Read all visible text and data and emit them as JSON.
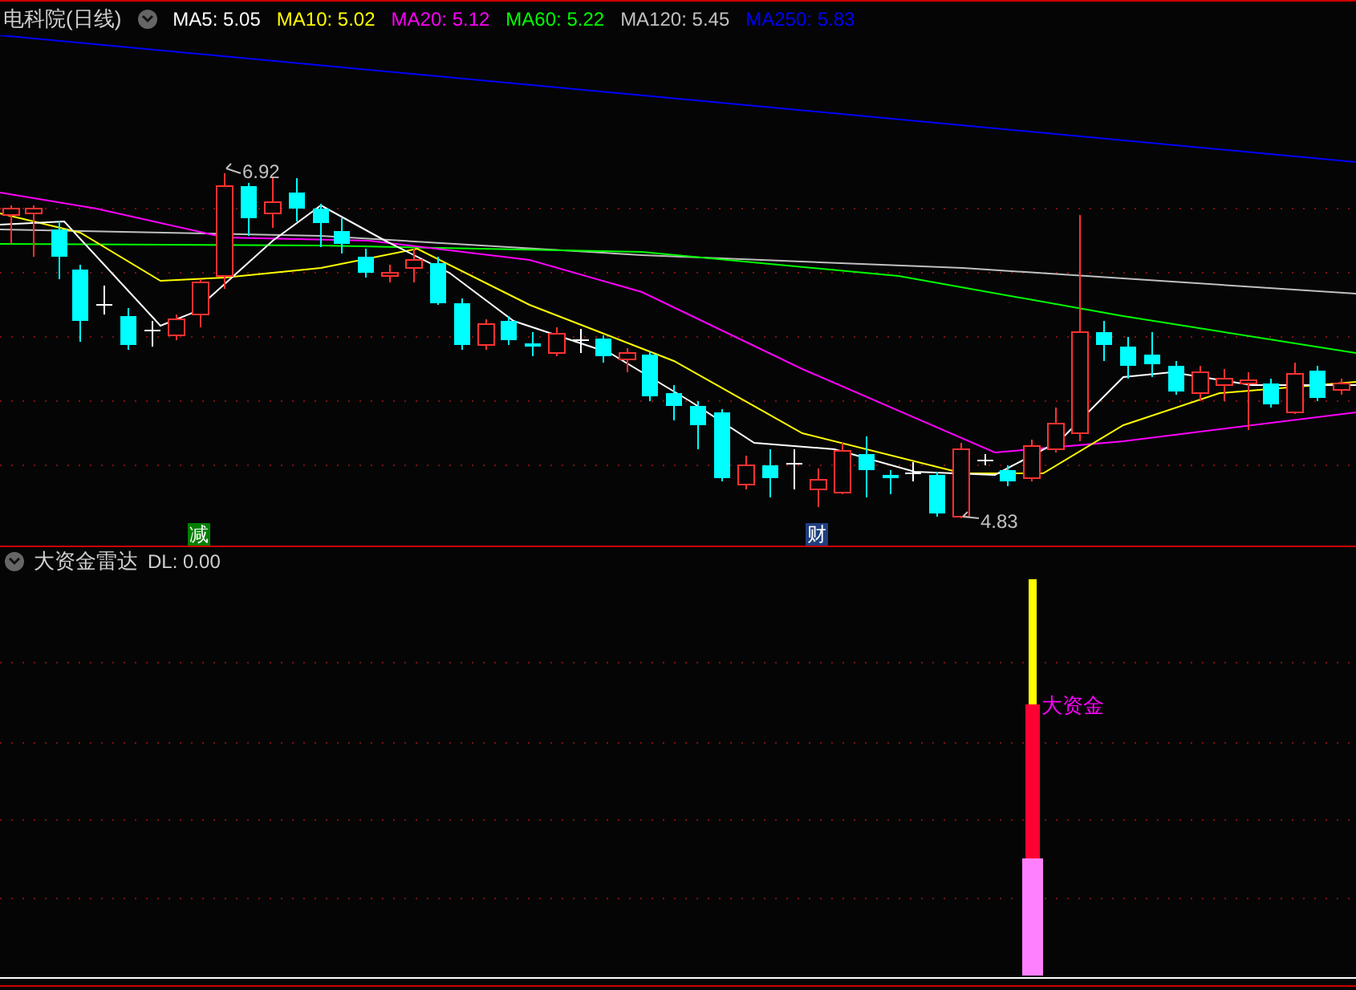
{
  "title": "电科院(日线)",
  "ma_legend": [
    {
      "label": "MA5:",
      "value": "5.05",
      "color": "#ffffff"
    },
    {
      "label": "MA10:",
      "value": "5.02",
      "color": "#ffff00"
    },
    {
      "label": "MA20:",
      "value": "5.12",
      "color": "#ff00ff"
    },
    {
      "label": "MA60:",
      "value": "5.22",
      "color": "#00ff00"
    },
    {
      "label": "MA120:",
      "value": "5.45",
      "color": "#c0c0c0"
    },
    {
      "label": "MA250:",
      "value": "5.83",
      "color": "#0000ff"
    }
  ],
  "price_chart": {
    "high_label": "6.92",
    "low_label": "4.83",
    "markers": [
      {
        "text": "减",
        "color": "#008000"
      },
      {
        "text": "财",
        "color": "#1f3f7f"
      }
    ]
  },
  "indicator": {
    "title": "大资金雷达",
    "reading": "DL: 0.00",
    "bar_label": "大资金"
  }
}
